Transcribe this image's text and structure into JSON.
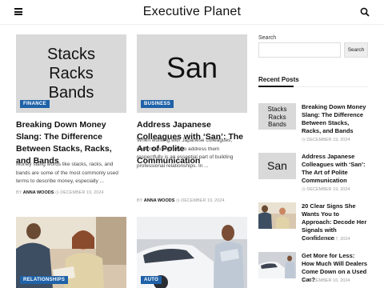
{
  "header": {
    "site_title": "Executive Planet"
  },
  "posts": [
    {
      "thumb_lines": [
        "Stacks",
        "Racks",
        "Bands"
      ],
      "category": "FINANCE",
      "title": "Breaking Down Money Slang: The Difference Between Stacks, Racks, and Bands",
      "excerpt": "Money slang words like stacks, racks, and bands are some of the most commonly used terms to describe money, especially ...",
      "by": "BY",
      "author": "ANNA WOODS",
      "date": "DECEMBER 19, 2024"
    },
    {
      "thumb_lines": [
        "San"
      ],
      "category": "BUSINESS",
      "title": "Address Japanese Colleagues with ‘San’: The Art of Polite Communication",
      "excerpt": "When working with Japanese colleagues, understanding how to address them respectfully is an essential part of building professional relationships.  In ...",
      "by": "BY",
      "author": "ANNA WOODS",
      "date": "DECEMBER 19, 2024"
    },
    {
      "category": "RELATIONSHIPS",
      "image": "cafe-people-photo"
    },
    {
      "category": "AUTO",
      "image": "car-dealership-photo"
    }
  ],
  "sidebar": {
    "search_label": "Search",
    "search_placeholder": "",
    "search_button": "Search",
    "recent_heading": "Recent Posts",
    "recent": [
      {
        "thumb_lines": [
          "Stacks",
          "Racks",
          "Bands"
        ],
        "title": "Breaking Down Money Slang: The Difference Between Stacks, Racks, and Bands",
        "date": "DECEMBER 19, 2024"
      },
      {
        "thumb_lines": [
          "San"
        ],
        "title": "Address Japanese Colleagues with ‘San’: The Art of Polite Communication",
        "date": "DECEMBER 19, 2024"
      },
      {
        "image": "cafe-people-photo",
        "title": "20 Clear Signs She Wants You to Approach: Decode Her Signals with Confidence",
        "date": "DECEMBER 17, 2024"
      },
      {
        "image": "car-dealership-photo",
        "title": "Get More for Less: How Much Will Dealers Come Down on a Used Car?",
        "date": "DECEMBER 16, 2024"
      }
    ]
  }
}
